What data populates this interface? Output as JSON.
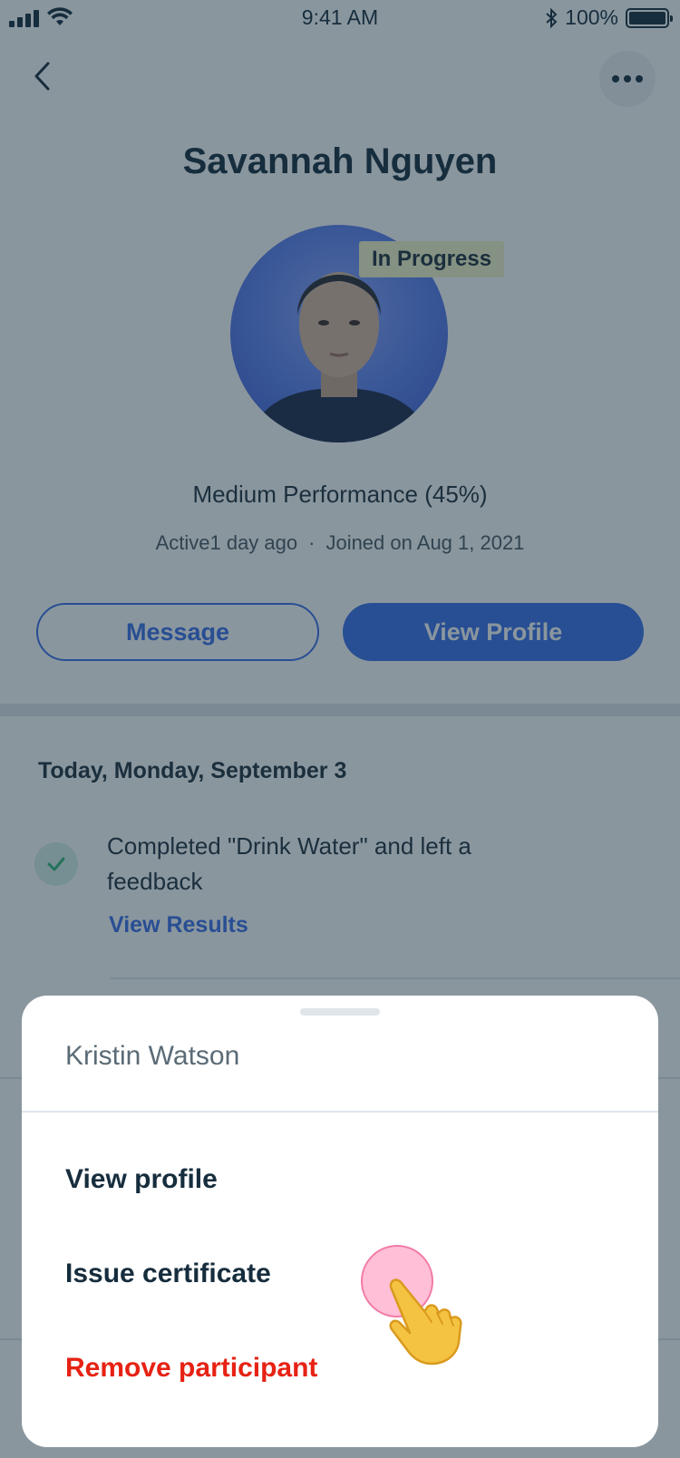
{
  "status_bar": {
    "time": "9:41 AM",
    "battery": "100%",
    "signal_bars": 4,
    "battery_level": 1.0
  },
  "header": {
    "title": "Savannah Nguyen",
    "back_icon": "chevron-left-icon",
    "more_icon": "more-horizontal-icon"
  },
  "profile": {
    "status_badge": "In Progress",
    "performance": "Medium Performance (45%)",
    "active_text": "Active1 day ago",
    "separator": "·",
    "joined_text": "Joined on Aug 1, 2021"
  },
  "actions": {
    "message_label": "Message",
    "view_profile_label": "View Profile"
  },
  "activity": {
    "date_heading": "Today, Monday, September 3",
    "items": [
      {
        "text": "Completed \"Drink Water\" and left a feedback",
        "link_label": "View Results",
        "icon": "check-icon"
      }
    ]
  },
  "sheet": {
    "title": "Kristin Watson",
    "items": [
      {
        "label": "View profile"
      },
      {
        "label": "Issue certificate"
      },
      {
        "label": "Remove participant"
      }
    ]
  },
  "colors": {
    "accent": "#3b6ee8",
    "text_dark": "#162d3d",
    "danger": "#e62214",
    "badge_bg": "#f2f4c8",
    "success_bg": "#d7f0e8",
    "success": "#32b67a"
  }
}
